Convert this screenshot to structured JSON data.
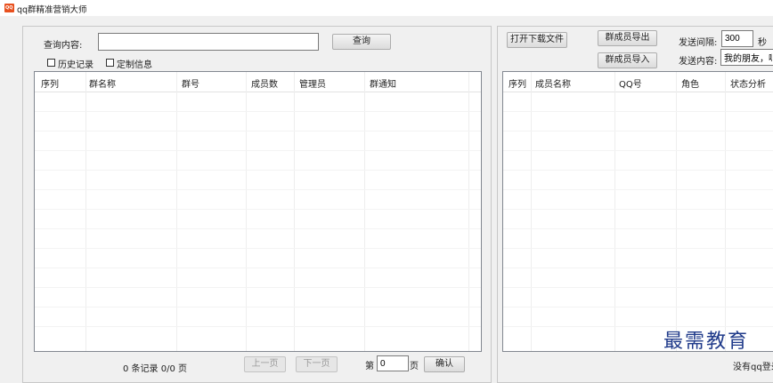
{
  "window": {
    "title": "qq群精准营销大师",
    "app_icon_text": "QQ"
  },
  "query": {
    "label": "查询内容:",
    "value": "",
    "button": "查询"
  },
  "options": {
    "history": "历史记录",
    "custom_info": "定制信息"
  },
  "group_table": {
    "columns": [
      "序列",
      "群名称",
      "群号",
      "成员数",
      "管理员",
      "群通知"
    ]
  },
  "pager": {
    "record_info": "0 条记录 0/0 页",
    "prev": "上一页",
    "next": "下一页",
    "page_prefix": "第",
    "page_value": "0",
    "page_suffix": "页",
    "confirm": "确认"
  },
  "right": {
    "open_download_file": "打开下载文件",
    "export_members": "群成员导出",
    "import_members": "群成员导入",
    "send_interval_label": "发送间隔:",
    "send_interval_value": "300",
    "send_interval_unit": "秒",
    "send_content_label": "发送内容:",
    "send_content_value": "我的朋友，嗯"
  },
  "member_table": {
    "columns": [
      "序列",
      "成员名称",
      "QQ号",
      "角色",
      "状态分析"
    ]
  },
  "status_text": "没有qq登录",
  "watermark": "最需教育"
}
